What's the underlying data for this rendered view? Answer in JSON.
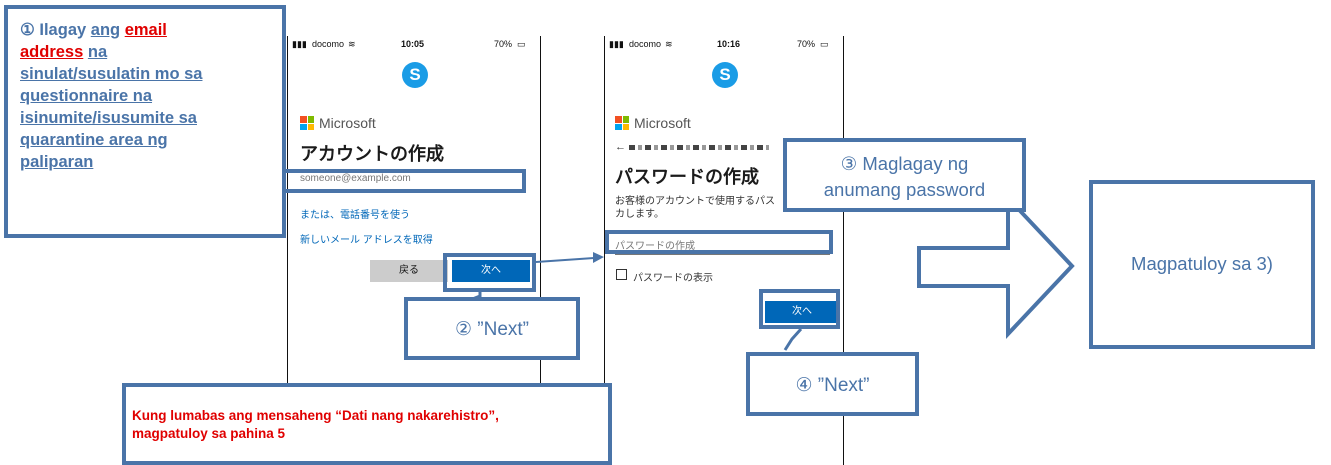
{
  "callout1": {
    "num": "①",
    "ilagay": "Ilagay",
    "ang": "ang",
    "email": "email",
    "address": "address",
    "na": "na",
    "line3": "sinulat/susulatin mo sa",
    "line4": "questionnaire na",
    "line5": "isinumite/isusumite sa",
    "line6": "quarantine area ng",
    "line7": "paliparan"
  },
  "callout2": {
    "text": "② ”Next”"
  },
  "callout3": {
    "line1": "③ Maglagay ng",
    "line2": "anumang password"
  },
  "callout4": {
    "text": "④ ”Next”"
  },
  "callout5": {
    "text": "Magpatuloy sa 3)"
  },
  "notice": {
    "line1": "Kung lumabas ang mensaheng “Dati nang nakarehistro”,",
    "line2": "magpatuloy sa pahina 5"
  },
  "phone1": {
    "carrier": "docomo",
    "time": "10:05",
    "battery": "70%",
    "skype_letter": "S",
    "brand": "Microsoft",
    "title": "アカウントの作成",
    "email_placeholder": "someone@example.com",
    "phone_option": "または、電話番号を使う",
    "new_email": "新しいメール アドレスを取得",
    "back_button": "戻る",
    "next_button": "次へ"
  },
  "phone2": {
    "carrier": "docomo",
    "time": "10:16",
    "battery": "70%",
    "skype_letter": "S",
    "brand": "Microsoft",
    "title": "パスワードの作成",
    "desc1": "お客様のアカウントで使用するパス",
    "desc2": "カします。",
    "password_placeholder": "パスワードの作成",
    "show_password": "パスワードの表示",
    "next_button": "次へ"
  },
  "colors": {
    "callout_border": "#4a74a8",
    "red": "#e00000",
    "button_blue": "#0067b8"
  }
}
